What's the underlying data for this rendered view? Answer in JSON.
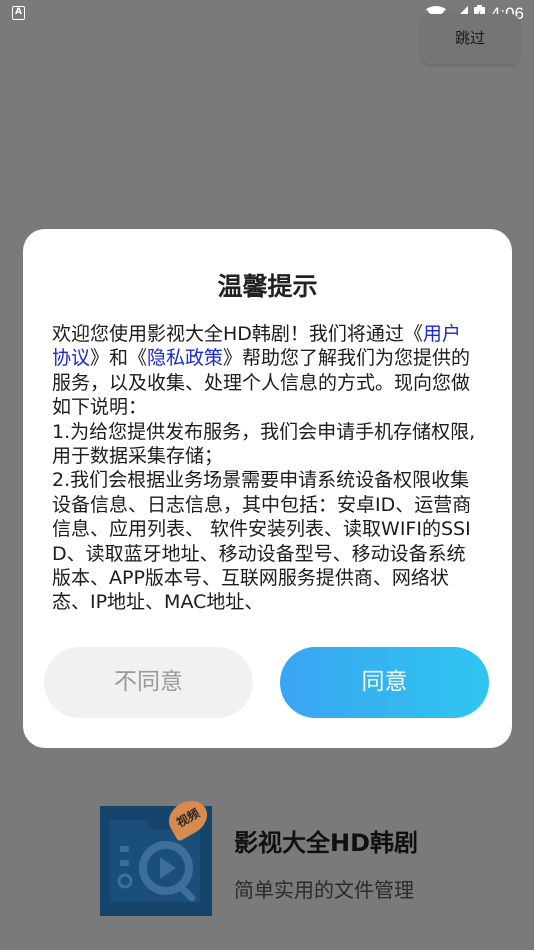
{
  "status_bar": {
    "indicator": "A",
    "time": "4:06",
    "icons": [
      "wifi-icon",
      "signal-icon",
      "battery-icon"
    ]
  },
  "skip_label": "跳过",
  "dialog": {
    "title": "温馨提示",
    "body": {
      "p1_before": "欢迎您使用影视大全HD韩剧！我们将通过《",
      "link_user": "用户协议",
      "p1_mid": "》和《",
      "link_privacy": "隐私政策",
      "p1_after": "》帮助您了解我们为您提供的服务，以及收集、处理个人信息的方式。现向您做如下说明：",
      "p2": "1.为给您提供发布服务，我们会申请手机存储权限, 用于数据采集存储；",
      "p3": "2.我们会根据业务场景需要申请系统设备权限收集设备信息、日志信息，其中包括：安卓ID、运营商信息、应用列表、 软件安装列表、读取WIFI的SSID、读取蓝牙地址、移动设备型号、移动设备系统版本、APP版本号、互联网服务提供商、网络状态、IP地址、MAC地址、"
    },
    "disagree_label": "不同意",
    "agree_label": "同意"
  },
  "brand": {
    "badge": "视频",
    "name": "影视大全HD韩剧",
    "slogan": "简单实用的文件管理"
  },
  "colors": {
    "link": "#1a2ad6",
    "agree_start": "#3aa4f2",
    "agree_end": "#2fc6f0",
    "overlay": "#7a7a7a",
    "logo_bg": "#16446a",
    "badge": "#d98a4e"
  }
}
